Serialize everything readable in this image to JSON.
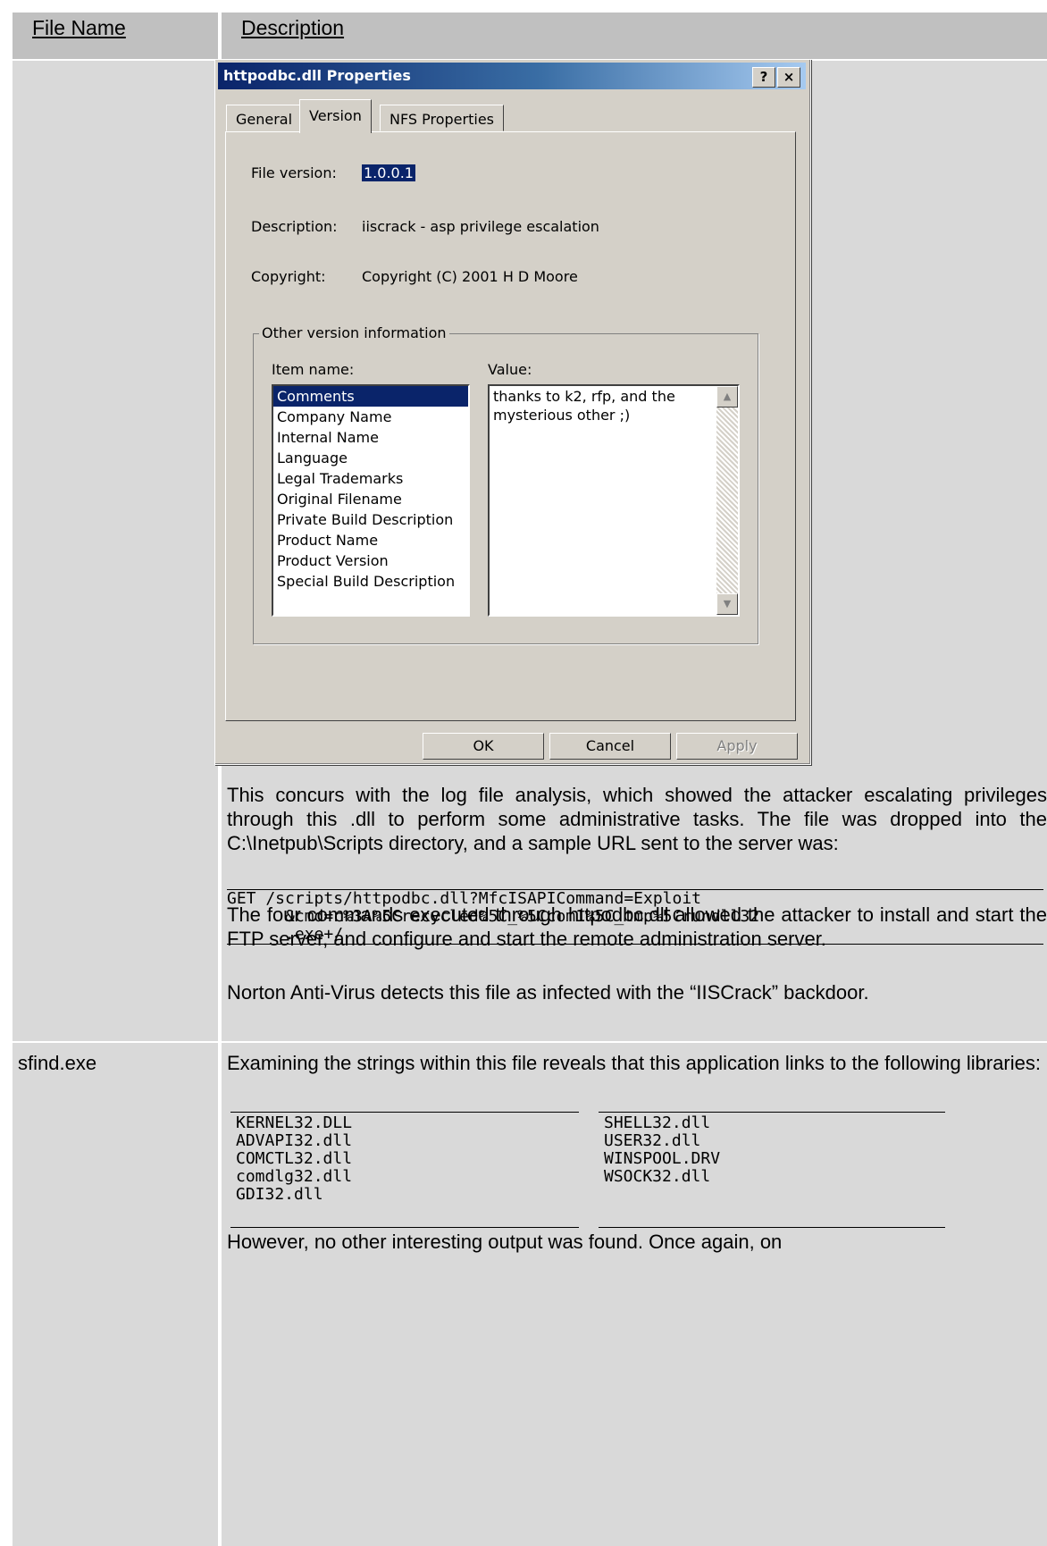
{
  "table": {
    "headers": {
      "file_name": "File Name",
      "description": "Description"
    },
    "row1": {
      "file_name": "",
      "dialog": {
        "title": "httpodbc.dll Properties",
        "title_buttons": {
          "help": "?",
          "close": "×"
        },
        "tabs": [
          "General",
          "Version",
          "NFS Properties"
        ],
        "active_tab": "Version",
        "file_version_label": "File version:",
        "file_version_value": "1.0.0.1",
        "description_label": "Description:",
        "description_value": "iiscrack - asp privilege escalation",
        "copyright_label": "Copyright:",
        "copyright_value": "Copyright (C) 2001 H D Moore",
        "group_label": "Other version information",
        "item_name_label": "Item name:",
        "value_label": "Value:",
        "items": [
          "Comments",
          "Company Name",
          "Internal Name",
          "Language",
          "Legal Trademarks",
          "Original Filename",
          "Private Build Description",
          "Product Name",
          "Product Version",
          "Special Build Description"
        ],
        "selected_item": "Comments",
        "value_text": "thanks to k2, rfp, and the mysterious other ;)",
        "buttons": {
          "ok": "OK",
          "cancel": "Cancel",
          "apply": "Apply"
        }
      },
      "para1": "This concurs with the log file analysis, which showed the attacker escalating privileges through this .dll to perform some administrative tasks.  The file was dropped into the C:\\Inetpub\\Scripts directory, and a sample URL sent to the server was:",
      "code": "GET /scripts/httpodbc.dll?MfcISAPICommand=Exploit\n      &cmd=c%3A%5Crecycled%5C_%5Ccom1%5C_tmp%5Crundll32\n      .exe+/",
      "para2": "The four commands executed through httpodbc.dll allowed the attacker to install and start the FTP server, and configure and start the remote administration server.",
      "para3": "Norton Anti-Virus detects this file as infected with the “IISCrack” backdoor."
    },
    "row2": {
      "file_name": "sfind.exe",
      "para1": "Examining the strings within this file reveals that this application links to the following libraries:",
      "libs_left": "KERNEL32.DLL\nADVAPI32.dll\nCOMCTL32.dll\ncomdlg32.dll\nGDI32.dll",
      "libs_right": "SHELL32.dll\nUSER32.dll\nWINSPOOL.DRV\nWSOCK32.dll",
      "para2": "However, no other interesting output was found. Once again, on"
    }
  }
}
